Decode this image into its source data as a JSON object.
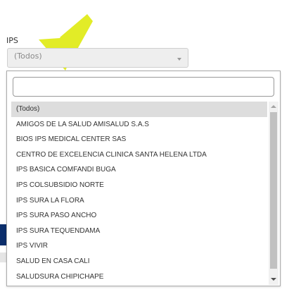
{
  "field": {
    "label": "IPS",
    "selected_value": "(Todos)"
  },
  "dropdown": {
    "search_value": "",
    "options": [
      "(Todos)",
      "AMIGOS DE LA SALUD AMISALUD S.A.S",
      "BIOS IPS MEDICAL CENTER SAS",
      "CENTRO DE EXCELENCIA CLINICA SANTA HELENA LTDA",
      "IPS BASICA COMFANDI BUGA",
      "IPS COLSUBSIDIO NORTE",
      "IPS SURA LA FLORA",
      "IPS SURA PASO ANCHO",
      "IPS SURA TEQUENDAMA",
      "IPS VIVIR",
      "SALUD EN CASA CALI",
      "SALUDSURA CHIPICHAPE"
    ],
    "highlighted_index": 0
  },
  "annotation": {
    "arrow_color": "#e2ec27"
  },
  "colors": {
    "side_stripe": "#0b2e6b",
    "highlight": "#dddddd"
  }
}
